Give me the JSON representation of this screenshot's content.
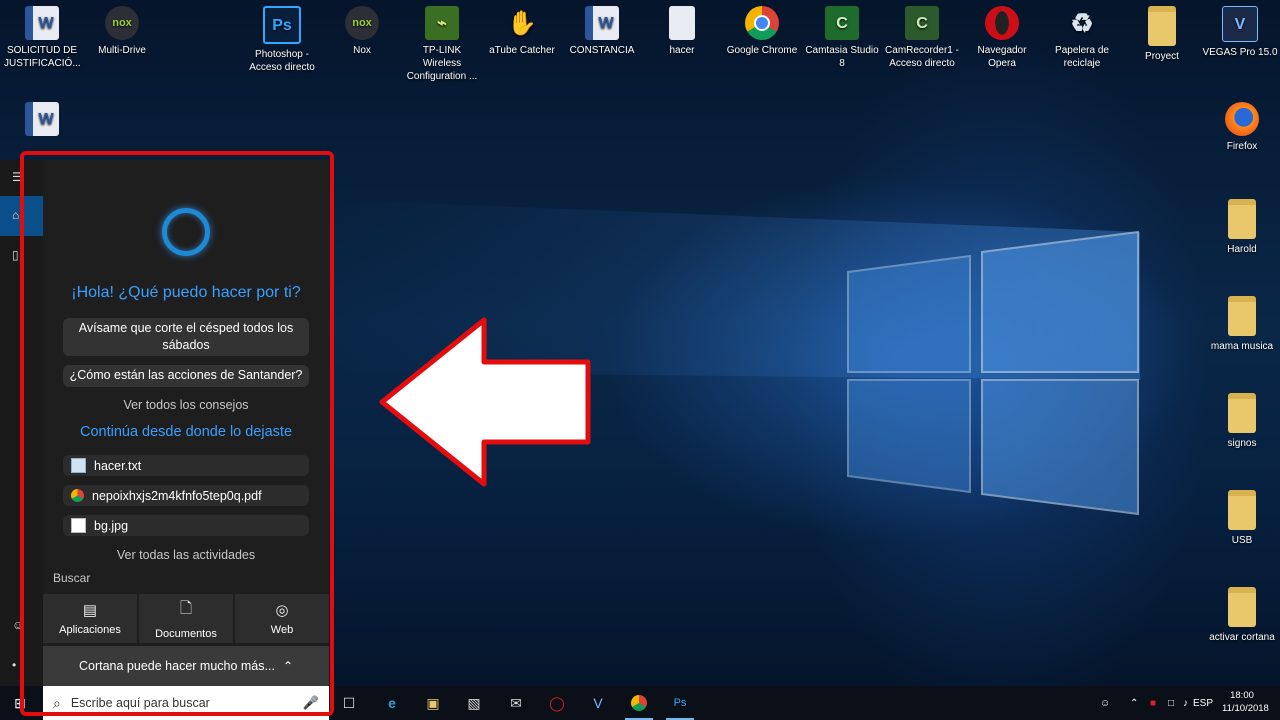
{
  "desktop": {
    "icons_top": [
      {
        "label": "SOLICITUD DE JUSTIFICACIÓ...",
        "icon": "word-doc-icon"
      },
      {
        "label": "Multi-Drive",
        "icon": "nox-multidrive-icon"
      },
      {
        "label": "Photoshop - Acceso directo",
        "icon": "photoshop-icon"
      },
      {
        "label": "Nox",
        "icon": "nox-icon"
      },
      {
        "label": "TP-LINK Wireless Configuration ...",
        "icon": "tplink-icon"
      },
      {
        "label": "aTube Catcher",
        "icon": "atube-catcher-icon"
      },
      {
        "label": "CONSTANCIA",
        "icon": "word-doc-icon"
      },
      {
        "label": "hacer",
        "icon": "text-file-icon"
      },
      {
        "label": "Google Chrome",
        "icon": "chrome-icon"
      },
      {
        "label": "Camtasia Studio 8",
        "icon": "camtasia-icon"
      },
      {
        "label": "CamRecorder1 - Acceso directo",
        "icon": "camrecorder-icon"
      },
      {
        "label": "Navegador Opera",
        "icon": "opera-icon"
      },
      {
        "label": "Papelera de reciclaje",
        "icon": "recycle-bin-icon"
      },
      {
        "label": "Proyect",
        "icon": "folder-icon"
      },
      {
        "label": "VEGAS Pro 15.0",
        "icon": "vegas-icon"
      }
    ],
    "icons_right": [
      {
        "label": "Firefox",
        "icon": "firefox-icon"
      },
      {
        "label": "Harold",
        "icon": "folder-icon"
      },
      {
        "label": "mama musica",
        "icon": "folder-icon"
      },
      {
        "label": "signos",
        "icon": "folder-icon"
      },
      {
        "label": "USB",
        "icon": "folder-icon"
      },
      {
        "label": "activar cortana",
        "icon": "folder-icon"
      }
    ]
  },
  "cortana": {
    "greeting": "¡Hola! ¿Qué puedo hacer por ti?",
    "suggestions": [
      "Avísame que corte el césped todos los sábados",
      "¿Cómo están las acciones de Santander?"
    ],
    "see_all_tips": "Ver todos los consejos",
    "continue_heading": "Continúa desde donde lo dejaste",
    "recent_items": [
      {
        "name": "hacer.txt",
        "icon": "text-file-icon"
      },
      {
        "name": "nepoixhxjs2m4kfnfo5tep0q.pdf",
        "icon": "chrome-icon"
      },
      {
        "name": "bg.jpg",
        "icon": "image-icon"
      }
    ],
    "see_all_activities": "Ver todas las actividades",
    "search_label": "Buscar",
    "tiles": [
      {
        "label": "Aplicaciones",
        "icon": "apps-icon"
      },
      {
        "label": "Documentos",
        "icon": "document-icon"
      },
      {
        "label": "Web",
        "icon": "globe-icon"
      }
    ],
    "more_label": "Cortana puede hacer mucho más...",
    "search_placeholder": "Escribe aquí para buscar"
  },
  "taskbar": {
    "language": "ESP",
    "time": "18:00",
    "date": "11/10/2018"
  },
  "colors": {
    "accent": "#3aa0ff",
    "highlight_red": "#e30d0d",
    "panel_bg": "#1e1e1e"
  }
}
